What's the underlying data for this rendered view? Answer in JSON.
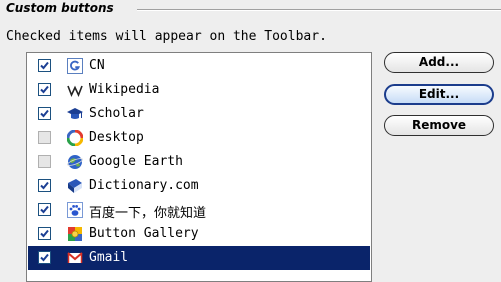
{
  "group": {
    "title": "Custom buttons"
  },
  "instruction": "Checked items will appear on the Toolbar.",
  "buttons": {
    "add": "Add...",
    "edit": "Edit...",
    "remove": "Remove"
  },
  "items": [
    {
      "label": "CN",
      "checked": true,
      "icon": "google-cn-icon",
      "selected": false
    },
    {
      "label": "Wikipedia",
      "checked": true,
      "icon": "wikipedia-icon",
      "selected": false
    },
    {
      "label": "Scholar",
      "checked": true,
      "icon": "scholar-cap-icon",
      "selected": false
    },
    {
      "label": "Desktop",
      "checked": false,
      "icon": "google-desktop-icon",
      "selected": false
    },
    {
      "label": "Google Earth",
      "checked": false,
      "icon": "google-earth-icon",
      "selected": false
    },
    {
      "label": "Dictionary.com",
      "checked": true,
      "icon": "dictionary-book-icon",
      "selected": false
    },
    {
      "label": "百度一下，你就知道",
      "checked": true,
      "icon": "baidu-paw-icon",
      "selected": false
    },
    {
      "label": "Button Gallery",
      "checked": true,
      "icon": "button-gallery-icon",
      "selected": false
    },
    {
      "label": "Gmail",
      "checked": true,
      "icon": "gmail-icon",
      "selected": true
    }
  ]
}
